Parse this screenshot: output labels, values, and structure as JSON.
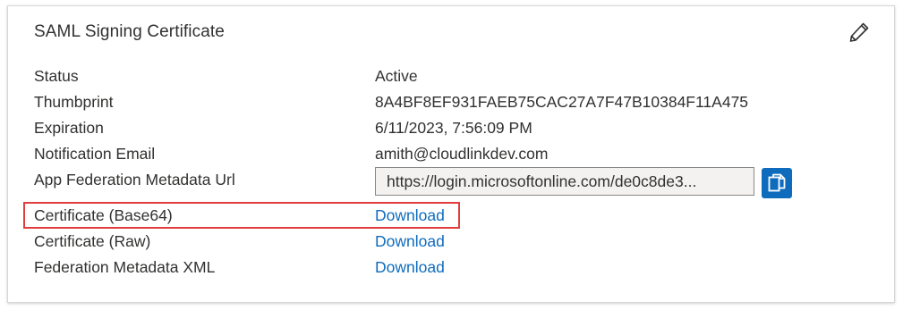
{
  "card": {
    "title": "SAML Signing Certificate",
    "edit_icon": "pencil-icon"
  },
  "fields": {
    "status": {
      "label": "Status",
      "value": "Active"
    },
    "thumbprint": {
      "label": "Thumbprint",
      "value": "8A4BF8EF931FAEB75CAC27A7F47B10384F11A475"
    },
    "expiration": {
      "label": "Expiration",
      "value": "6/11/2023, 7:56:09 PM"
    },
    "notification_email": {
      "label": "Notification Email",
      "value": "amith@cloudlinkdev.com"
    },
    "metadata_url": {
      "label": "App Federation Metadata Url",
      "value": "https://login.microsoftonline.com/de0c8de3...",
      "copy_icon": "copy-icon"
    },
    "cert_base64": {
      "label": "Certificate (Base64)",
      "link": "Download"
    },
    "cert_raw": {
      "label": "Certificate (Raw)",
      "link": "Download"
    },
    "federation_xml": {
      "label": "Federation Metadata XML",
      "link": "Download"
    }
  },
  "colors": {
    "link": "#0f6cbd",
    "copy_button": "#0f6cbd",
    "highlight_border": "#e23c3c",
    "text": "#323130"
  }
}
